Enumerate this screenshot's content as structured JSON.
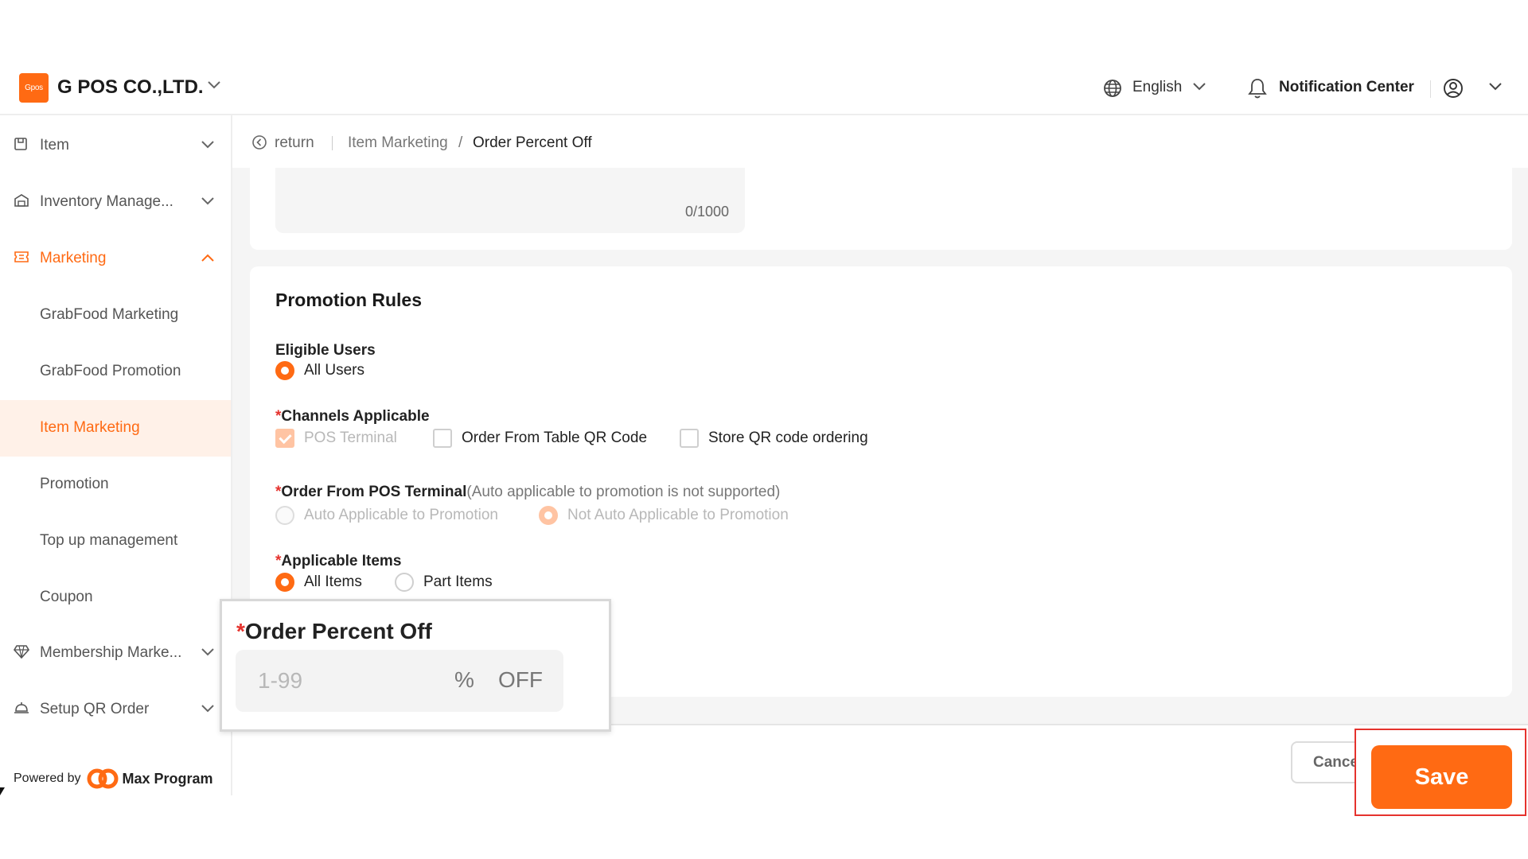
{
  "header": {
    "logo_text": "Gpos",
    "company": "G POS CO.,LTD.",
    "language": "English",
    "notification": "Notification Center"
  },
  "colors": {
    "accent": "#ff6a13",
    "required": "#e5322d",
    "highlight_border": "#e5322d"
  },
  "sidebar": {
    "items": [
      {
        "label": "Item",
        "icon": "box-icon"
      },
      {
        "label": "Inventory Manage...",
        "icon": "warehouse-icon"
      },
      {
        "label": "Marketing",
        "icon": "ticket-icon",
        "expanded": true
      },
      {
        "label": "Membership Marke...",
        "icon": "gem-icon"
      },
      {
        "label": "Setup QR Order",
        "icon": "cloche-icon"
      }
    ],
    "marketing_children": [
      {
        "label": "GrabFood Marketing"
      },
      {
        "label": "GrabFood Promotion"
      },
      {
        "label": "Item Marketing",
        "selected": true
      },
      {
        "label": "Promotion"
      },
      {
        "label": "Top up management"
      },
      {
        "label": "Coupon"
      }
    ],
    "powered_by": "Powered by",
    "brand": "Max Program"
  },
  "breadcrumb": {
    "return": "return",
    "item1": "Item Marketing",
    "separator": "/",
    "item2": "Order Percent Off"
  },
  "description": {
    "counter": "0/1000"
  },
  "rules": {
    "title": "Promotion Rules",
    "eligible_users": {
      "label": "Eligible Users",
      "options": [
        "All Users"
      ],
      "selected": "All Users"
    },
    "channels": {
      "required_mark": "*",
      "label": "Channels Applicable",
      "options": [
        "POS Terminal",
        "Order From Table QR Code",
        "Store QR code ordering"
      ],
      "checked": [
        "POS Terminal"
      ]
    },
    "pos_terminal": {
      "required_mark": "*",
      "label": "Order From POS Terminal",
      "hint": "(Auto applicable to promotion is not supported)",
      "options": [
        "Auto Applicable to Promotion",
        "Not Auto Applicable to Promotion"
      ],
      "selected": "Not Auto Applicable to Promotion"
    },
    "applicable_items": {
      "required_mark": "*",
      "label": "Applicable Items",
      "options": [
        "All Items",
        "Part Items"
      ],
      "selected": "All Items"
    }
  },
  "percent_off": {
    "required_mark": "*",
    "label": "Order Percent Off",
    "placeholder": "1-99",
    "suffix_pct": "%",
    "suffix_off": "OFF"
  },
  "footer": {
    "cancel": "Cancel",
    "save": "Save"
  }
}
